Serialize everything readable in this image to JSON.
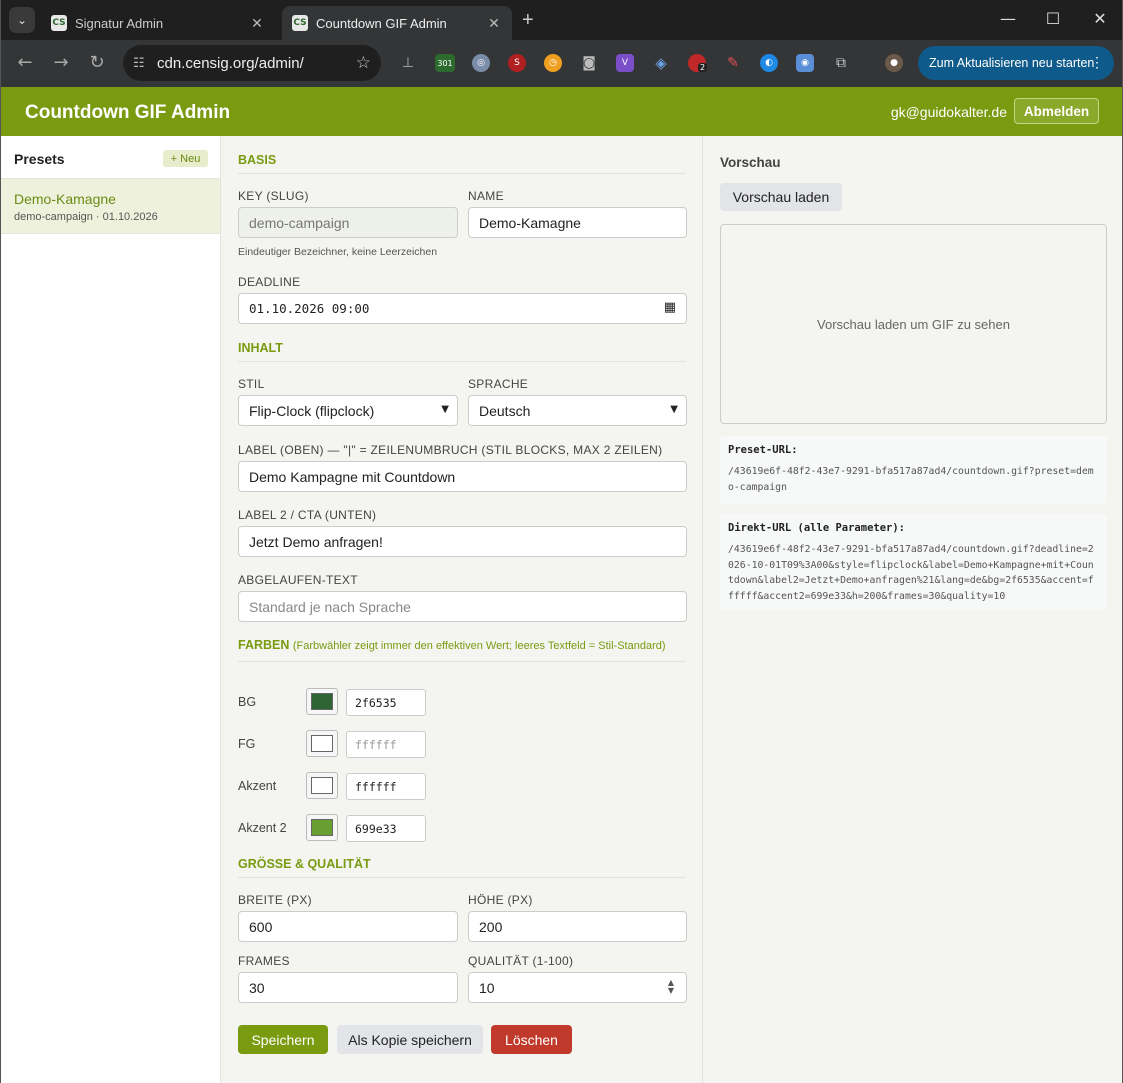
{
  "browser": {
    "tabs": [
      {
        "title": "Signatur Admin",
        "favicon": "CS"
      },
      {
        "title": "Countdown GIF Admin",
        "favicon": "CS"
      }
    ],
    "url": "cdn.censig.org/admin/",
    "update_button": "Zum Aktualisieren neu starten",
    "extension_badges": {
      "counter": "301",
      "notifications": "2"
    }
  },
  "header": {
    "title": "Countdown GIF Admin",
    "user_email": "gk@guidokalter.de",
    "logout_label": "Abmelden"
  },
  "sidebar": {
    "title": "Presets",
    "new_label": "+ Neu",
    "presets": [
      {
        "name": "Demo-Kamagne",
        "meta": "demo-campaign · 01.10.2026"
      }
    ]
  },
  "form": {
    "basis_section": "BASIS",
    "key_label": "KEY (SLUG)",
    "key_value": "demo-campaign",
    "key_hint": "Eindeutiger Bezeichner, keine Leerzeichen",
    "name_label": "NAME",
    "name_value": "Demo-Kamagne",
    "deadline_label": "DEADLINE",
    "deadline_value": "01.10.2026 09:00",
    "inhalt_section": "INHALT",
    "stil_label": "STIL",
    "stil_value": "Flip-Clock (flipclock)",
    "sprache_label": "SPRACHE",
    "sprache_value": "Deutsch",
    "label1_label": "LABEL (OBEN) — \"|\" = ZEILENUMBRUCH (STIL BLOCKS, MAX 2 ZEILEN)",
    "label1_value": "Demo Kampagne mit Countdown",
    "label2_label": "LABEL 2 / CTA (UNTEN)",
    "label2_value": "Jetzt Demo anfragen!",
    "expired_label": "ABGELAUFEN-TEXT",
    "expired_placeholder": "Standard je nach Sprache",
    "farben_section": "FARBEN",
    "farben_note": "(Farbwähler zeigt immer den effektiven Wert; leeres Textfeld = Stil-Standard)",
    "colors": [
      {
        "label": "BG",
        "swatch": "#2f6535",
        "value": "2f6535",
        "placeholder": false
      },
      {
        "label": "FG",
        "swatch": "#ffffff",
        "value": "ffffff",
        "placeholder": true
      },
      {
        "label": "Akzent",
        "swatch": "#ffffff",
        "value": "ffffff",
        "placeholder": false
      },
      {
        "label": "Akzent 2",
        "swatch": "#699e33",
        "value": "699e33",
        "placeholder": false
      }
    ],
    "size_section": "GRÖSSE & QUALITÄT",
    "width_label": "BREITE (PX)",
    "width_value": "600",
    "height_label": "HÖHE (PX)",
    "height_value": "200",
    "frames_label": "FRAMES",
    "frames_value": "30",
    "quality_label": "QUALITÄT (1-100)",
    "quality_value": "10",
    "save_label": "Speichern",
    "copy_label": "Als Kopie speichern",
    "delete_label": "Löschen"
  },
  "preview": {
    "title": "Vorschau",
    "load_label": "Vorschau laden",
    "empty_text": "Vorschau laden um GIF zu sehen",
    "preset_url_label": "Preset-URL:",
    "preset_url": "/43619e6f-48f2-43e7-9291-bfa517a87ad4/countdown.gif?preset=demo-campaign",
    "direct_url_label": "Direkt-URL (alle Parameter):",
    "direct_url": "/43619e6f-48f2-43e7-9291-bfa517a87ad4/countdown.gif?deadline=2026-10-01T09%3A00&style=flipclock&label=Demo+Kampagne+mit+Countdown&label2=Jetzt+Demo+anfragen%21&lang=de&bg=2f6535&accent=ffffff&accent2=699e33&h=200&frames=30&quality=10"
  },
  "colors": {
    "brand": "#7a9a10",
    "delete": "#c0392b"
  }
}
